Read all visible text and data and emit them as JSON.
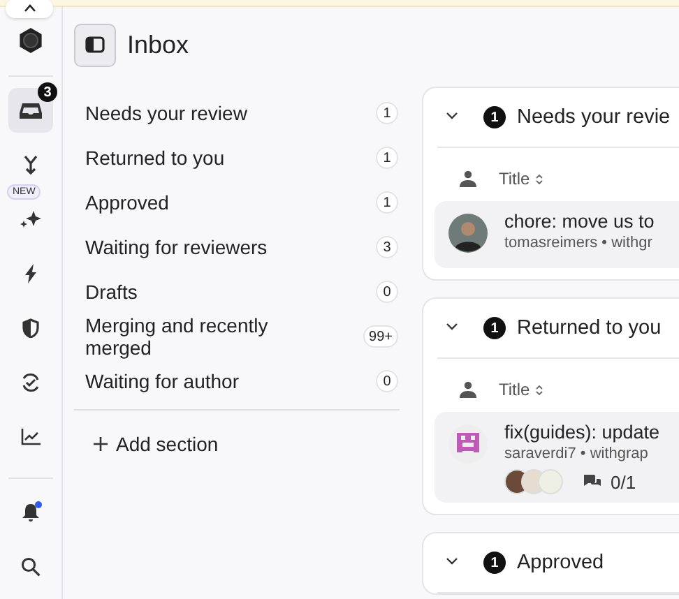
{
  "rail": {
    "items": [
      {
        "kind": "inbox",
        "selected": true,
        "badge": "3"
      },
      {
        "kind": "merge",
        "selected": false
      },
      {
        "kind": "sparkle",
        "selected": false,
        "tag": "NEW"
      },
      {
        "kind": "bolt",
        "selected": false
      },
      {
        "kind": "shield",
        "selected": false
      },
      {
        "kind": "sync",
        "selected": false
      },
      {
        "kind": "chart",
        "selected": false
      },
      {
        "kind": "bell",
        "selected": false,
        "dot": true
      },
      {
        "kind": "search",
        "selected": false
      }
    ]
  },
  "header": {
    "title": "Inbox"
  },
  "sections": [
    {
      "label": "Needs your review",
      "count": "1"
    },
    {
      "label": "Returned to you",
      "count": "1"
    },
    {
      "label": "Approved",
      "count": "1"
    },
    {
      "label": "Waiting for reviewers",
      "count": "3"
    },
    {
      "label": "Drafts",
      "count": "0"
    },
    {
      "label": "Merging and recently merged",
      "count": "99+"
    },
    {
      "label": "Waiting for author",
      "count": "0"
    }
  ],
  "add_section": "Add section",
  "cards": [
    {
      "title": "Needs your revie",
      "count": "1",
      "expanded": true,
      "column": "Title",
      "rows": [
        {
          "avatar": {
            "kind": "photo"
          },
          "title": "chore: move us to",
          "meta": "tomasreimers • withgr"
        }
      ]
    },
    {
      "title": "Returned to you",
      "count": "1",
      "expanded": true,
      "column": "Title",
      "rows": [
        {
          "avatar": {
            "kind": "identicon"
          },
          "title": "fix(guides): update",
          "meta": "saraverdi7 • withgrap",
          "reviewers": [
            {
              "color": "#6b4a3a"
            },
            {
              "color": "#e6dccf"
            },
            {
              "color": "#eef0e6"
            }
          ],
          "comments": "0/1"
        }
      ]
    },
    {
      "title": "Approved",
      "count": "1",
      "expanded": true
    }
  ]
}
